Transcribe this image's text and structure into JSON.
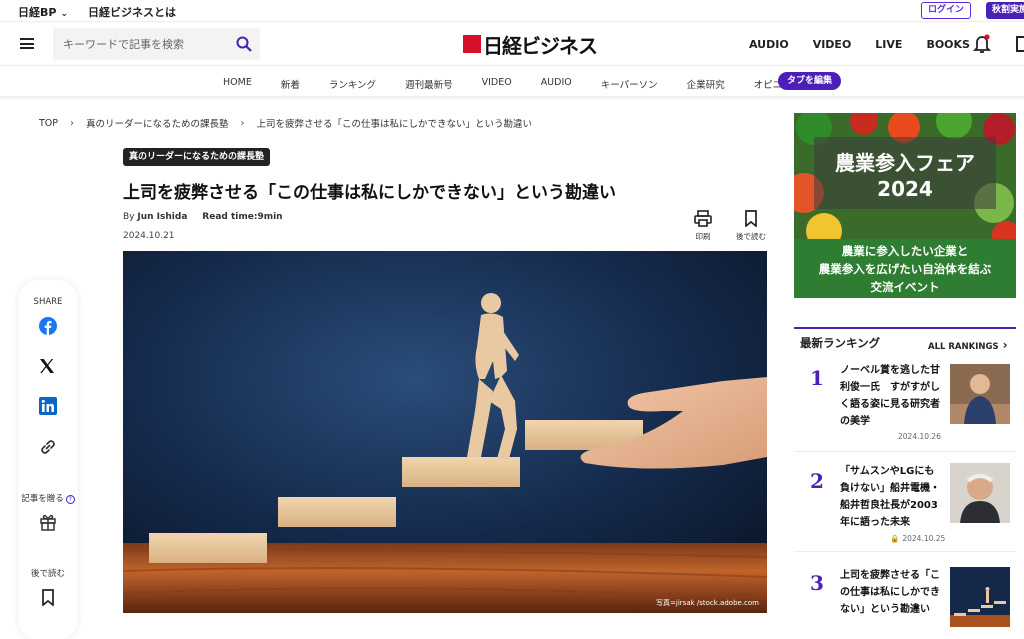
{
  "utility": {
    "brand": "日経BP",
    "about": "日経ビジネスとは",
    "login": "ログイン",
    "promo": "秋割実施中"
  },
  "header": {
    "search_placeholder": "キーワードで記事を検索",
    "logo": "日経ビジネス",
    "nav": [
      "AUDIO",
      "VIDEO",
      "LIVE",
      "BOOKS"
    ]
  },
  "categories": {
    "items": [
      "HOME",
      "新着",
      "ランキング",
      "週刊最新号",
      "VIDEO",
      "AUDIO",
      "キーパーソン",
      "企業研究",
      "オピニオン"
    ],
    "tab_edit": "タブを編集"
  },
  "breadcrumb": [
    "TOP",
    "真のリーダーになるための課長塾",
    "上司を疲弊させる「この仕事は私にしかできない」という勘違い"
  ],
  "article": {
    "tag": "真のリーダーになるための課長塾",
    "title": "上司を疲弊させる「この仕事は私にしかできない」という勘違い",
    "by_prefix": "By",
    "author": "Jun Ishida",
    "read_label": "Read time:",
    "read_value": "9min",
    "date": "2024.10.21",
    "print_label": "印刷",
    "save_label": "後で読む",
    "photo_credit": "写真=jirsak /stock.adobe.com"
  },
  "share": {
    "label": "SHARE",
    "gift_label": "記事を贈る",
    "later_label": "後で読む"
  },
  "ad": {
    "title_line1": "農業参入フェア",
    "title_line2": "2024",
    "body_line1": "農業に参入したい企業と",
    "body_line2": "農業参入を広げたい自治体を結ぶ",
    "body_line3": "交流イベント"
  },
  "ranking": {
    "heading": "最新ランキング",
    "all": "ALL RANKINGS",
    "items": [
      {
        "num": "1",
        "title": "ノーベル賞を逃した甘利俊一氏　すがすがしく語る姿に見る研究者の美学",
        "date": "2024.10.26"
      },
      {
        "num": "2",
        "title": "「サムスンやLGにも負けない」船井電機・船井哲良社長が2003年に語った未来",
        "date": "2024.10.25"
      },
      {
        "num": "3",
        "title": "上司を疲弊させる「この仕事は私にしかできない」という勘違い",
        "date": ""
      }
    ]
  },
  "colors": {
    "accent": "#4b1fb8",
    "logo_red": "#d8102a",
    "ad_green": "#2e7d32"
  }
}
